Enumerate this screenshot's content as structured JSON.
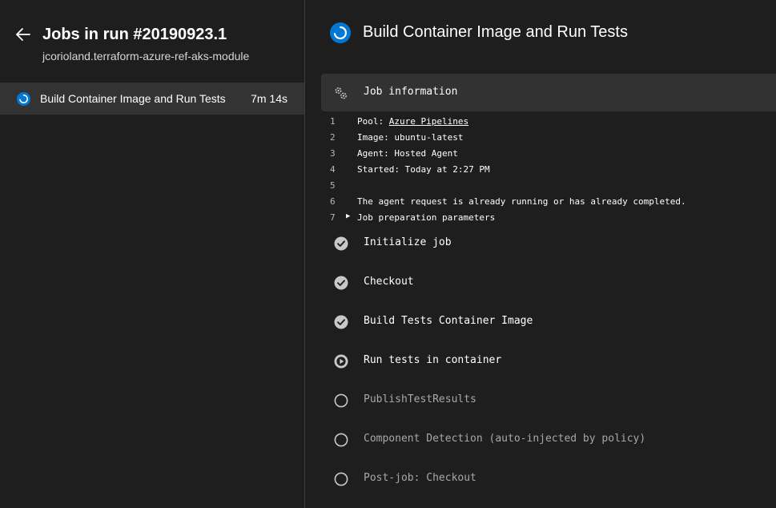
{
  "left": {
    "title": "Jobs in run #20190923.1",
    "repo": "jcorioland.terraform-azure-ref-aks-module",
    "job": {
      "name": "Build Container Image and Run Tests",
      "duration": "7m 14s"
    }
  },
  "right": {
    "title": "Build Container Image and Run Tests",
    "section_title": "Job information",
    "log_lines": [
      {
        "n": "1",
        "prefix": "Pool: ",
        "link": "Azure Pipelines",
        "text": ""
      },
      {
        "n": "2",
        "prefix": "",
        "link": "",
        "text": "Image: ubuntu-latest"
      },
      {
        "n": "3",
        "prefix": "",
        "link": "",
        "text": "Agent: Hosted Agent"
      },
      {
        "n": "4",
        "prefix": "",
        "link": "",
        "text": "Started: Today at 2:27 PM"
      },
      {
        "n": "5",
        "prefix": "",
        "link": "",
        "text": ""
      },
      {
        "n": "6",
        "prefix": "",
        "link": "",
        "text": "The agent request is already running or has already completed."
      },
      {
        "n": "7",
        "prefix": "",
        "link": "",
        "text": "Job preparation parameters"
      }
    ],
    "steps": [
      {
        "name": "Initialize job",
        "status": "succeeded"
      },
      {
        "name": "Checkout",
        "status": "succeeded"
      },
      {
        "name": "Build Tests Container Image",
        "status": "succeeded"
      },
      {
        "name": "Run tests in container",
        "status": "running"
      },
      {
        "name": "PublishTestResults",
        "status": "pending"
      },
      {
        "name": "Component Detection (auto-injected by policy)",
        "status": "pending"
      },
      {
        "name": "Post-job: Checkout",
        "status": "pending"
      }
    ]
  },
  "colors": {
    "accent_blue": "#0078d4",
    "background": "#1e1e1e",
    "selected_row": "#333333",
    "section_bar": "#323232",
    "success_gray": "#c8c8c8",
    "pending_text": "#a8a8a8"
  },
  "icons": {
    "back": "arrow-left-icon",
    "job_status": "in-progress-icon",
    "section": "gears-icon",
    "succeeded": "check-circle-icon",
    "running": "play-circle-icon",
    "pending": "empty-circle-icon"
  }
}
